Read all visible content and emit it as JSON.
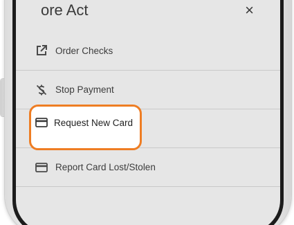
{
  "header": {
    "title": "ore Act",
    "right_glyph": "×"
  },
  "menu": {
    "items": [
      {
        "label": "Order Checks",
        "icon": "external-link-icon"
      },
      {
        "label": "Stop Payment",
        "icon": "no-dollar-icon"
      },
      {
        "label": "Request New Card",
        "icon": "credit-card-icon"
      },
      {
        "label": "Report Card Lost/Stolen",
        "icon": "credit-card-icon"
      }
    ]
  },
  "highlight": {
    "item_index": 2,
    "color": "#ee7d23"
  },
  "colors": {
    "screen_background": "#e6e6e6",
    "divider": "#c9c9c9",
    "text": "#3c3c3c",
    "accent": "#ee7d23"
  }
}
